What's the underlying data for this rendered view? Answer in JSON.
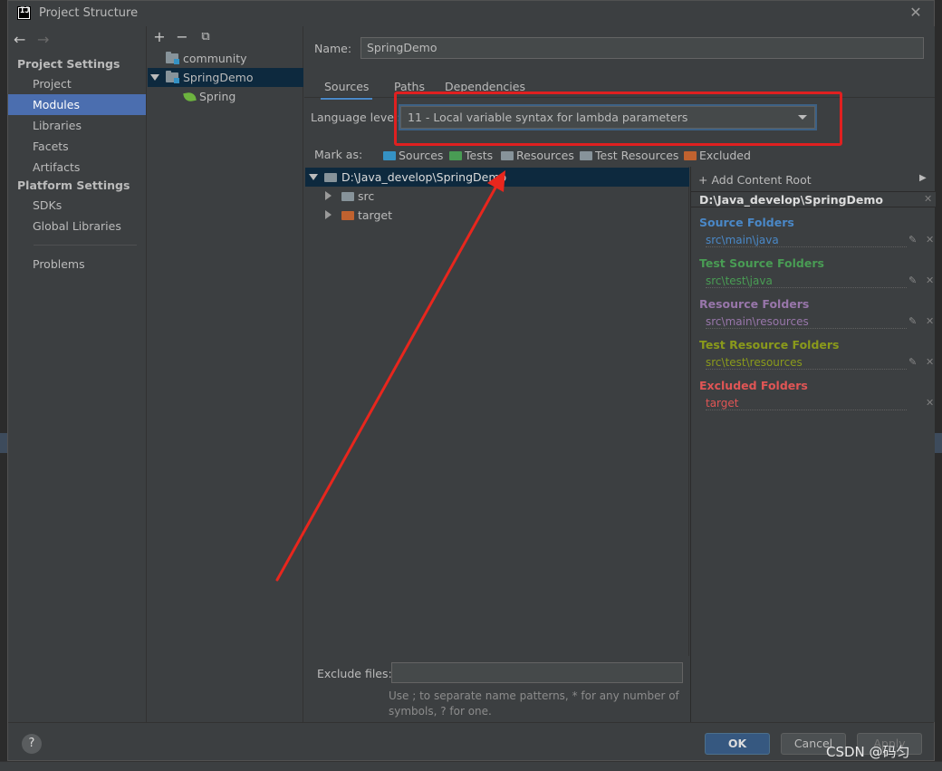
{
  "window": {
    "title": "Project Structure"
  },
  "nav": {
    "project_settings_header": "Project Settings",
    "project_items": [
      "Project",
      "Modules",
      "Libraries",
      "Facets",
      "Artifacts"
    ],
    "selected_item": "Modules",
    "platform_settings_header": "Platform Settings",
    "platform_items": [
      "SDKs",
      "Global Libraries"
    ],
    "problems": "Problems"
  },
  "module_tree": {
    "toolbar_icons": [
      "add-icon",
      "remove-icon",
      "copy-icon"
    ],
    "items": [
      {
        "label": "community",
        "icon": "module-folder-icon"
      },
      {
        "label": "SpringDemo",
        "icon": "module-folder-icon",
        "selected": true,
        "expanded": true
      },
      {
        "label": "Spring",
        "icon": "spring-leaf-icon"
      }
    ]
  },
  "module": {
    "name_label": "Name:",
    "name_value": "SpringDemo",
    "tabs": [
      "Sources",
      "Paths",
      "Dependencies"
    ],
    "active_tab": "Sources",
    "language_level_label": "Language level:",
    "language_level_value": "11 - Local variable syntax for lambda parameters",
    "mark_as_label": "Mark as:",
    "mark_as_buttons": [
      {
        "label": "Sources",
        "color": "#3592c4"
      },
      {
        "label": "Tests",
        "color": "#499c54"
      },
      {
        "label": "Resources",
        "color": "#87939a"
      },
      {
        "label": "Test Resources",
        "color": "#87939a"
      },
      {
        "label": "Excluded",
        "color": "#c75450"
      }
    ]
  },
  "content_tree": {
    "root": "D:\\Java_develop\\SpringDemo",
    "children": [
      {
        "label": "src",
        "color": "#87939a"
      },
      {
        "label": "target",
        "color": "#c0622f"
      }
    ]
  },
  "roots_panel": {
    "add_content_root": "+ Add Content Root",
    "root_path": "D:\\Java_develop\\SpringDemo",
    "groups": [
      {
        "title": "Source Folders",
        "item": "src\\main\\java",
        "color": "#4a88c7"
      },
      {
        "title": "Test Source Folders",
        "item": "src\\test\\java",
        "color": "#499c54"
      },
      {
        "title": "Resource Folders",
        "item": "src\\main\\resources",
        "color": "#9876aa"
      },
      {
        "title": "Test Resource Folders",
        "item": "src\\test\\resources",
        "color": "#8a9a1b"
      },
      {
        "title": "Excluded Folders",
        "item": "target",
        "color": "#e05555"
      }
    ]
  },
  "exclude": {
    "label": "Exclude files:",
    "value": "",
    "hint": "Use ; to separate name patterns, * for any number of symbols, ? for one."
  },
  "footer": {
    "help": "?",
    "ok": "OK",
    "cancel": "Cancel",
    "apply": "Apply"
  },
  "watermark": "CSDN @码匀"
}
